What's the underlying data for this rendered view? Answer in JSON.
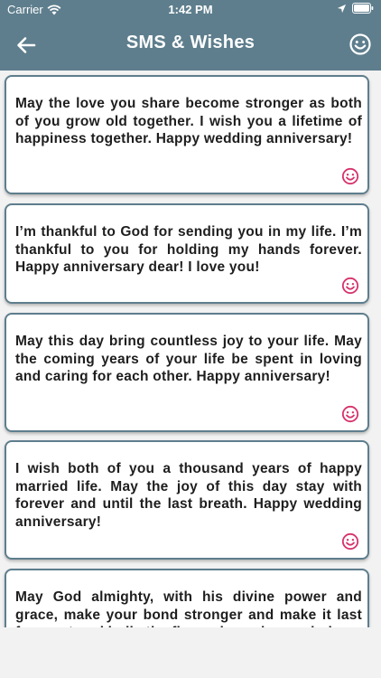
{
  "status_bar": {
    "carrier": "Carrier",
    "time": "1:42 PM",
    "icons": [
      "wifi-icon",
      "location-icon",
      "battery-icon"
    ]
  },
  "nav": {
    "title": "SMS & Wishes",
    "back_icon": "arrow-left-icon",
    "right_icon": "smiley-icon"
  },
  "colors": {
    "header": "#5e7e8d",
    "card_border": "#5e7e8d",
    "card_icon": "#d6336c",
    "background": "#f2f2f2",
    "text": "#1e1e1e"
  },
  "messages": [
    {
      "text": "May the love you share become stronger as both of you grow old together. I wish you a lifetime of happiness together. Happy wedding anniversary!",
      "icon": "smiley-icon"
    },
    {
      "text": "I’m thankful to God for sending you in my life. I’m thankful to you for holding my hands forever. Happy anniversary dear! I love you!",
      "icon": "smiley-icon"
    },
    {
      "text": "May this day bring countless joy to your life. May the coming years of your life be spent in loving and caring for each other. Happy anniversary!",
      "icon": "smiley-icon"
    },
    {
      "text": "I wish both of you a thousand years of happy married life. May the joy of this day stay with forever and until the last breath. Happy wedding anniversary!",
      "icon": "smiley-icon"
    },
    {
      "text": " May God almighty, with his divine power and grace, make your bond stronger and make it last forever to rekindle the fire and passion each day",
      "icon": "smiley-icon"
    }
  ]
}
